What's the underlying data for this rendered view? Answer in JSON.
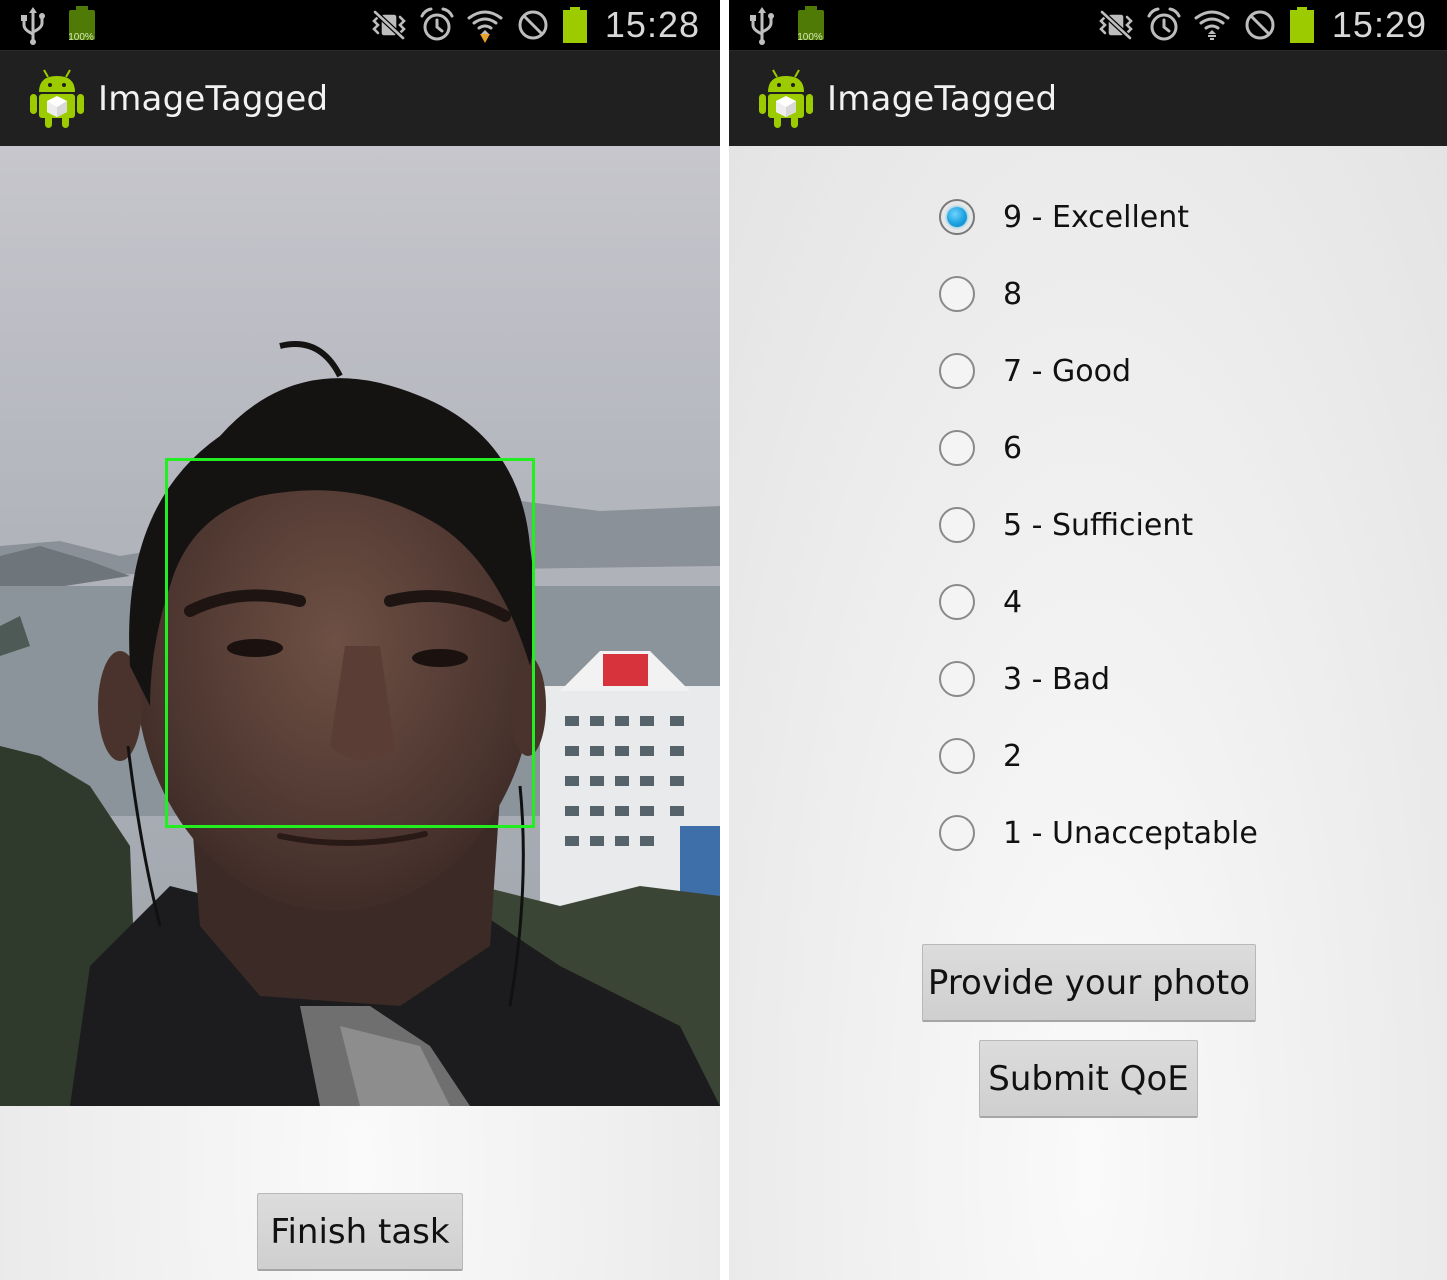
{
  "screens": [
    {
      "status_bar": {
        "battery_small_label": "100%",
        "time": "15:28"
      },
      "action_bar": {
        "title": "ImageTagged"
      },
      "finish_button_label": "Finish task"
    },
    {
      "status_bar": {
        "battery_small_label": "100%",
        "time": "15:29"
      },
      "action_bar": {
        "title": "ImageTagged"
      },
      "rating_options": [
        {
          "label": "9 - Excellent",
          "checked": true
        },
        {
          "label": "8",
          "checked": false
        },
        {
          "label": "7 - Good",
          "checked": false
        },
        {
          "label": "6",
          "checked": false
        },
        {
          "label": "5 - Sufficient",
          "checked": false
        },
        {
          "label": "4",
          "checked": false
        },
        {
          "label": "3 - Bad",
          "checked": false
        },
        {
          "label": "2",
          "checked": false
        },
        {
          "label": "1 - Unacceptable",
          "checked": false
        }
      ],
      "provide_photo_label": "Provide your photo",
      "submit_qoe_label": "Submit QoE"
    }
  ],
  "colors": {
    "accent": "#33b5e5",
    "face_box": "#22ee22",
    "battery": "#9ccc00",
    "action_bar": "#202020"
  },
  "icons": [
    "usb-icon",
    "battery-icon",
    "vibrate-icon",
    "alarm-icon",
    "wifi-icon",
    "no-sign-icon",
    "android-app-icon"
  ]
}
